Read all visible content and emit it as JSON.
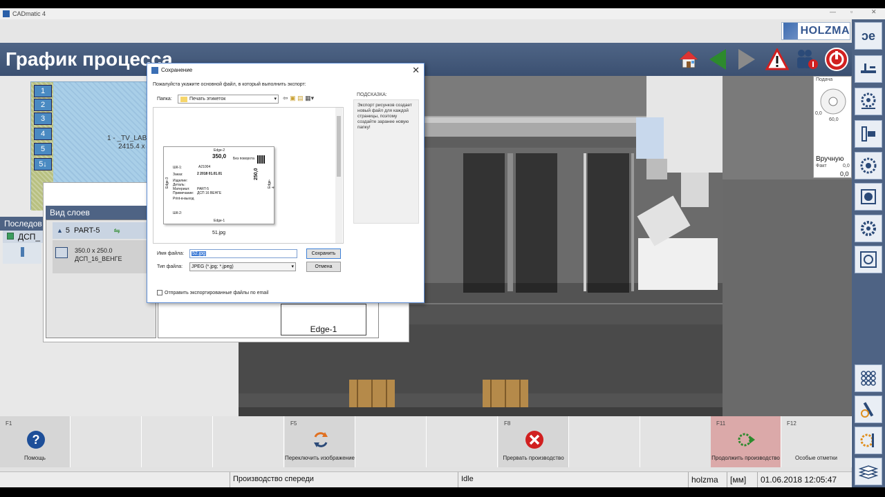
{
  "app": {
    "window_title": "CADmatic 4",
    "page_title": "График процесса",
    "brand": "HOLZMA",
    "colors": {
      "header_bg": "#45597a",
      "accent_green": "#2d8a2d",
      "danger_red": "#d12020"
    }
  },
  "header_buttons": [
    {
      "icon": "home-icon"
    },
    {
      "icon": "arrow-left-icon"
    },
    {
      "icon": "arrow-right-icon"
    },
    {
      "icon": "warning-icon"
    },
    {
      "icon": "operators-icon"
    },
    {
      "icon": "stop-icon"
    }
  ],
  "right_toolbar": [
    {
      "icon": "program-icon"
    },
    {
      "icon": "transport-icon"
    },
    {
      "icon": "saw-settings-icon"
    },
    {
      "icon": "clamp-icon"
    },
    {
      "icon": "blade-icon"
    },
    {
      "icon": "motor-icon"
    },
    {
      "icon": "gear-tool-icon"
    },
    {
      "icon": "pattern-icon"
    },
    {
      "icon": "grid-icon"
    },
    {
      "icon": "wrench-tool-icon"
    },
    {
      "icon": "tools-icon"
    },
    {
      "icon": "stack-icon"
    }
  ],
  "layout_thumb": {
    "parts": [
      "1",
      "2",
      "3",
      "4",
      "5",
      "5↓"
    ],
    "label_line1": "1 - _TV_LABLES_PR",
    "label_line2": "2415.4 x 2070"
  },
  "sequence": {
    "header": "Последов",
    "row_label": "ДСП_"
  },
  "layers": {
    "title": "Вид слоев",
    "row_num": "5",
    "part_name": "PART-5",
    "dims": "350.0 x 250.0",
    "material": "ДСП_16_ВЕНГЕ",
    "edge_label": "Edge-1"
  },
  "info_panel": {
    "feed_label": "Подача",
    "dial_left": "0,0",
    "dial_bottom": "60,0",
    "mode": "Вручную",
    "fact_label": "Факт",
    "fact_value": "0,0",
    "value": "0,0"
  },
  "dialog": {
    "title": "Сохранение",
    "prompt": "Пожалуйста укажите основной файл, в который выполнить экспорт:",
    "folder_label": "Папка:",
    "folder_value": "Печать этикеток",
    "hint_title": "ПОДСКАЗКА:",
    "hint_text": "Экспорт рисунков создает новый файл для каждой страницы, поэтому создайте заранее новую папку!",
    "thumb_caption": "51.jpg",
    "filename_label": "Имя файла:",
    "filename_value": "52.jpg",
    "filetype_label": "Тип файла:",
    "filetype_value": "JPEG (*.jpg; *.jpeg)",
    "save_button": "Сохранить",
    "cancel_button": "Отмена",
    "email_checkbox": "Отправить экспортированные файлы по email",
    "card": {
      "edge_top": "Edge-2",
      "value": "350,0",
      "corner_note": "Без поворота",
      "shk_label": "ШК-1:",
      "shk_value": "A21004",
      "order_label": "Заказ:",
      "order_value": "2  2018 01.01.01",
      "fields": "Изделие:\nДеталь:\nМатериал:\nПримечание:",
      "field_values": "\n\nPART-5\nДСП 16 ВЕНГЕ",
      "print_note": "Print-в-выход",
      "side_value": "250,0",
      "shk2_label": "ШК-2:",
      "edge_bottom": "Edge-1",
      "edge_left": "Edge-3",
      "edge_right": "Edge-4"
    }
  },
  "fkeys": [
    {
      "key": "F1",
      "label": "Помощь",
      "icon": "help-icon"
    },
    {
      "key": "",
      "label": ""
    },
    {
      "key": "",
      "label": ""
    },
    {
      "key": "",
      "label": ""
    },
    {
      "key": "F5",
      "label": "Переключить изображение",
      "icon": "switch-view-icon"
    },
    {
      "key": "",
      "label": ""
    },
    {
      "key": "",
      "label": ""
    },
    {
      "key": "F8",
      "label": "Прервать производство",
      "icon": "abort-icon"
    },
    {
      "key": "",
      "label": ""
    },
    {
      "key": "",
      "label": ""
    },
    {
      "key": "F11",
      "label": "Продолжить производство",
      "icon": "continue-icon"
    },
    {
      "key": "F12",
      "label": "Особые отметки",
      "icon": ""
    }
  ],
  "status": {
    "mode": "Производство спереди",
    "state": "Idle",
    "user": "holzma",
    "unit": "[мм]",
    "datetime": "01.06.2018 12:05:47"
  }
}
